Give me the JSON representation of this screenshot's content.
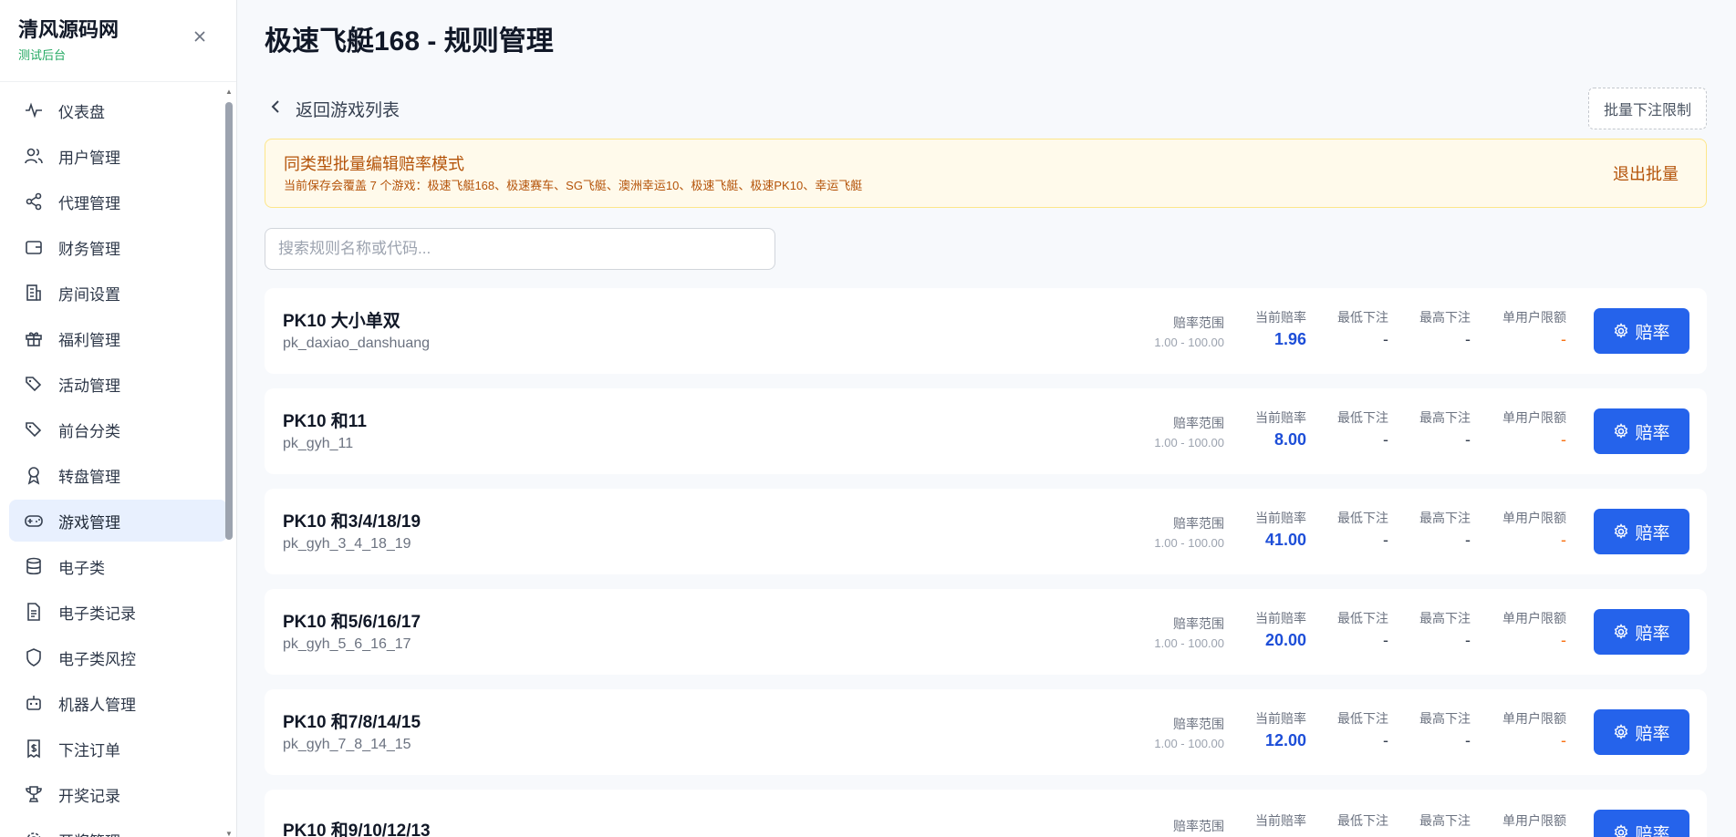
{
  "brand": {
    "title": "清风源码网",
    "subtitle": "测试后台"
  },
  "sidebar": {
    "items": [
      {
        "label": "仪表盘",
        "icon": "activity-icon"
      },
      {
        "label": "用户管理",
        "icon": "users-icon"
      },
      {
        "label": "代理管理",
        "icon": "share-icon"
      },
      {
        "label": "财务管理",
        "icon": "wallet-icon"
      },
      {
        "label": "房间设置",
        "icon": "building-icon"
      },
      {
        "label": "福利管理",
        "icon": "gift-icon"
      },
      {
        "label": "活动管理",
        "icon": "tags-icon"
      },
      {
        "label": "前台分类",
        "icon": "tags-icon"
      },
      {
        "label": "转盘管理",
        "icon": "award-icon"
      },
      {
        "label": "游戏管理",
        "icon": "gamepad-icon",
        "active": true
      },
      {
        "label": "电子类",
        "icon": "database-icon"
      },
      {
        "label": "电子类记录",
        "icon": "file-text-icon"
      },
      {
        "label": "电子类风控",
        "icon": "shield-icon"
      },
      {
        "label": "机器人管理",
        "icon": "bot-icon"
      },
      {
        "label": "下注订单",
        "icon": "receipt-icon"
      },
      {
        "label": "开奖记录",
        "icon": "trophy-icon"
      },
      {
        "label": "开奖管理",
        "icon": "settings-icon"
      }
    ]
  },
  "page": {
    "title": "极速飞艇168 - 规则管理"
  },
  "toolbar": {
    "back_label": "返回游戏列表",
    "batch_limit_label": "批量下注限制"
  },
  "notice": {
    "title": "同类型批量编辑赔率模式",
    "desc": "当前保存会覆盖 7 个游戏：极速飞艇168、极速赛车、SG飞艇、澳洲幸运10、极速飞艇、极速PK10、幸运飞艇",
    "exit_label": "退出批量"
  },
  "search": {
    "placeholder": "搜索规则名称或代码...",
    "value": ""
  },
  "columns": {
    "range": "赔率范围",
    "current": "当前赔率",
    "min": "最低下注",
    "max": "最高下注",
    "limit": "单用户限额"
  },
  "odds_button_label": "赔率",
  "rules": [
    {
      "name": "PK10 大小单双",
      "code": "pk_daxiao_danshuang",
      "range": "1.00 - 100.00",
      "current": "1.96",
      "min": "-",
      "max": "-",
      "limit": "-"
    },
    {
      "name": "PK10 和11",
      "code": "pk_gyh_11",
      "range": "1.00 - 100.00",
      "current": "8.00",
      "min": "-",
      "max": "-",
      "limit": "-"
    },
    {
      "name": "PK10 和3/4/18/19",
      "code": "pk_gyh_3_4_18_19",
      "range": "1.00 - 100.00",
      "current": "41.00",
      "min": "-",
      "max": "-",
      "limit": "-"
    },
    {
      "name": "PK10 和5/6/16/17",
      "code": "pk_gyh_5_6_16_17",
      "range": "1.00 - 100.00",
      "current": "20.00",
      "min": "-",
      "max": "-",
      "limit": "-"
    },
    {
      "name": "PK10 和7/8/14/15",
      "code": "pk_gyh_7_8_14_15",
      "range": "1.00 - 100.00",
      "current": "12.00",
      "min": "-",
      "max": "-",
      "limit": "-"
    },
    {
      "name": "PK10 和9/10/12/13",
      "code": "",
      "range": "",
      "current": "",
      "min": "-",
      "max": "-",
      "limit": "-"
    }
  ],
  "colors": {
    "accent": "#2563eb",
    "active_bg": "#e8f0fe",
    "notice_bg": "#fffaeb",
    "notice_text": "#b45309",
    "limit_text": "#f97316"
  }
}
